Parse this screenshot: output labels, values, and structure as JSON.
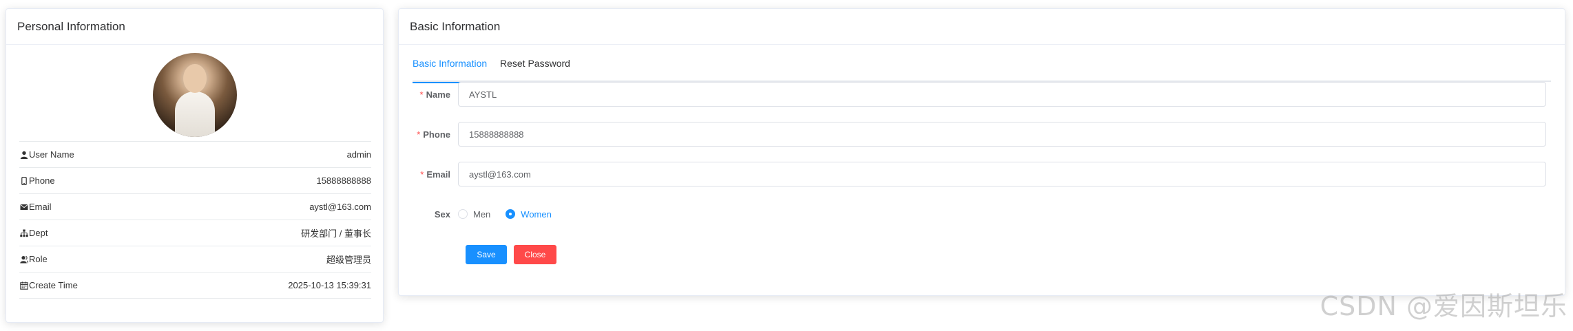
{
  "personal": {
    "title": "Personal Information",
    "rows": [
      {
        "icon": "user-icon",
        "label": "User Name",
        "value": "admin"
      },
      {
        "icon": "phone-icon",
        "label": "Phone",
        "value": "15888888888"
      },
      {
        "icon": "email-icon",
        "label": "Email",
        "value": "aystl@163.com"
      },
      {
        "icon": "tree-icon",
        "label": "Dept",
        "value": "研发部门 / 董事长"
      },
      {
        "icon": "peoples-icon",
        "label": "Role",
        "value": "超级管理员"
      },
      {
        "icon": "date-icon",
        "label": "Create Time",
        "value": "2025-10-13 15:39:31"
      }
    ]
  },
  "basic": {
    "title": "Basic Information",
    "tabs": [
      {
        "label": "Basic Information",
        "active": true
      },
      {
        "label": "Reset Password",
        "active": false
      }
    ],
    "form": {
      "name_label": "Name",
      "name_value": "AYSTL",
      "phone_label": "Phone",
      "phone_value": "15888888888",
      "email_label": "Email",
      "email_value": "aystl@163.com",
      "sex_label": "Sex",
      "sex_options": [
        "Men",
        "Women"
      ],
      "sex_selected": "Women",
      "required_mark": "*"
    },
    "buttons": {
      "save": "Save",
      "close": "Close"
    }
  },
  "watermark": "CSDN @爱因斯坦乐",
  "colors": {
    "primary": "#1890ff",
    "danger": "#ff4949",
    "required": "#ff4949"
  }
}
